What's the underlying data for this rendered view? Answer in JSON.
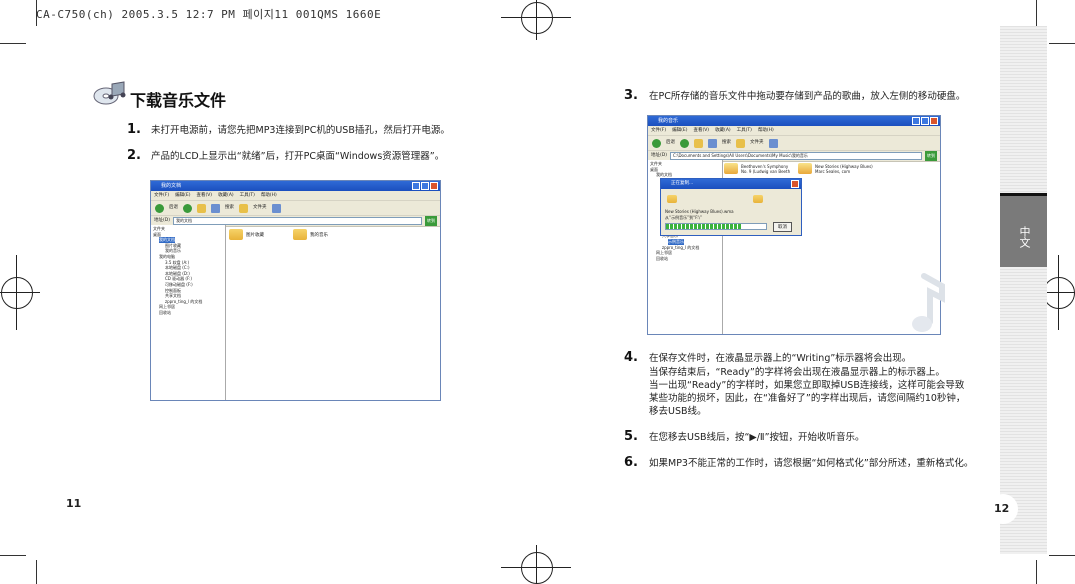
{
  "header": {
    "print_line": "CA-C750(ch) 2005.3.5 12:7 PM 페이지11   001QMS 1660E"
  },
  "left": {
    "title": "下载音乐文件",
    "steps": [
      {
        "num": "1.",
        "text": "未打开电源前，请您先把MP3连接到PC机的USB插孔，然后打开电源。"
      },
      {
        "num": "2.",
        "text": "产品的LCD上显示出“就绪”后，打开PC桌面“Windows资源管理器”。"
      }
    ],
    "page_number": "11",
    "screenshot": {
      "title": "我的文档",
      "menu": [
        "文件(F)",
        "编辑(E)",
        "查看(V)",
        "收藏(A)",
        "工具(T)",
        "帮助(H)"
      ],
      "toolbar": [
        "后退",
        "搜索",
        "文件夹"
      ],
      "address_label": "地址(D)",
      "address": "我的文档",
      "go": "转到",
      "tree_header": "文件夹",
      "tree": [
        "桌面",
        "我的文档",
        "图片收藏",
        "我的音乐",
        "我的电脑",
        "3.5 软盘 (A:)",
        "本地磁盘 (C:)",
        "本地磁盘 (D:)",
        "CD 驱动器 (F:)",
        "可移动磁盘 (F:)",
        "控制面板",
        "共享文档",
        "zppro_ting_l 的文档",
        "网上邻居",
        "回收站"
      ],
      "items": [
        "图片收藏",
        "我的音乐"
      ]
    }
  },
  "right": {
    "steps": [
      {
        "num": "3.",
        "lines": [
          "在PC所存储的音乐文件中拖动要存储到产品的歌曲，放入左侧的移动硬盘。"
        ]
      },
      {
        "num": "4.",
        "lines": [
          "在保存文件时，在液晶显示器上的“Writing”标示器将会出现。",
          "当保存结束后，“Ready”的字样将会出现在液晶显示器上的标示器上。",
          "当一出现“Ready”的字样时，如果您立即取掉USB连接线，这样可能会导致",
          "某些功能的损坏，因此，在“准备好了”的字样出现后，请您间隔约10秒钟，",
          "移去USB线。"
        ]
      },
      {
        "num": "5.",
        "lines": [
          "在您移去USB线后，按“▶/Ⅱ”按钮，开始收听音乐。"
        ]
      },
      {
        "num": "6.",
        "lines": [
          "如果MP3不能正常的工作时，请您根据“如何格式化”部分所述，重新格式化。"
        ]
      }
    ],
    "page_number": "12",
    "side_label": "中文",
    "screenshot": {
      "title": "我的音乐",
      "menu": [
        "文件(F)",
        "编辑(E)",
        "查看(V)",
        "收藏(A)",
        "工具(T)",
        "帮助(H)"
      ],
      "toolbar": [
        "后退",
        "搜索",
        "文件夹"
      ],
      "address_label": "地址(D)",
      "address": "C:\\Documents and Settings\\All Users\\Documents\\My Music\\我的音乐",
      "go": "转到",
      "tree_header": "文件夹",
      "tree": [
        "桌面",
        "我的文档",
        "共享图画",
        "共享音乐",
        "示例音乐",
        "zppro_ting_l 的文档",
        "网上邻居",
        "回收站"
      ],
      "files": [
        "Beethoven's Symphony No. 9 (Ludwig van Beeth",
        "New Stories (Highway Blues) Marc Seales, com"
      ],
      "dialog": {
        "title": "正在复制...",
        "file": "New Stories (Highway Blues).wma",
        "from": "从“示例音乐”到“F:\\”",
        "cancel": "取消",
        "progress": 0.75
      }
    }
  }
}
